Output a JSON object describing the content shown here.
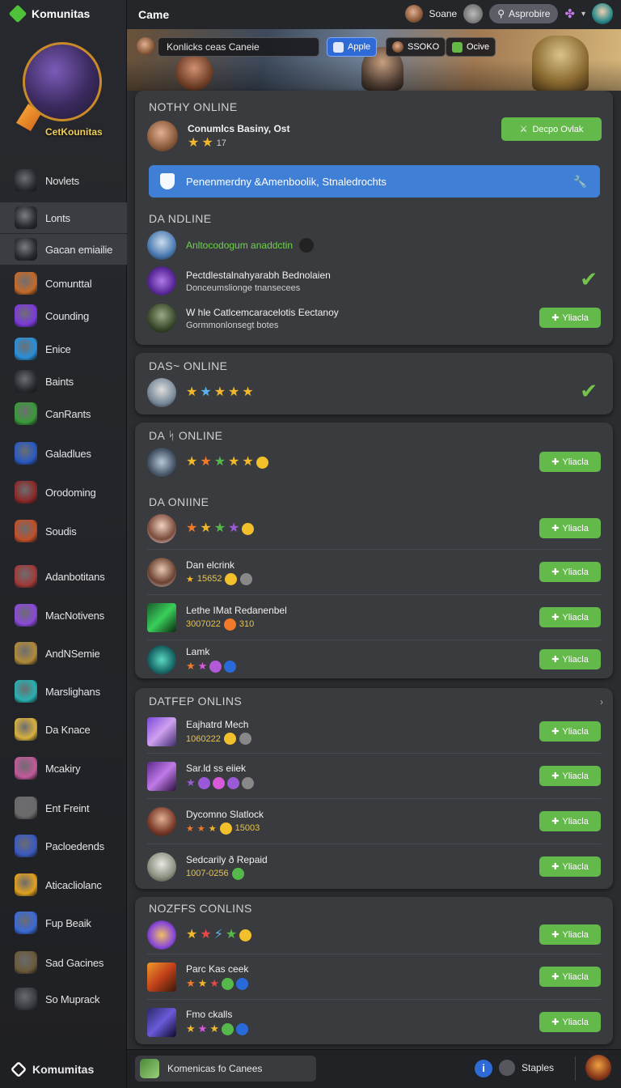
{
  "sidebar": {
    "brand": "Komunitas",
    "hero_label": "CetKounitas",
    "items": [
      {
        "label": "Novlets",
        "icon": "ninja-icon",
        "color": "#2b2d33"
      },
      {
        "label": "Lonts",
        "icon": "gear-icon",
        "color": "#2a2c31"
      },
      {
        "label": "Gacan emiailie",
        "icon": "plus-box-icon",
        "color": "#2a2c31"
      },
      {
        "label": "Comunttal",
        "icon": "chest-icon",
        "color": "#c46a2a"
      },
      {
        "label": "Counding",
        "icon": "crystal-icon",
        "color": "#7b3ad8"
      },
      {
        "label": "Enice",
        "icon": "star-icon",
        "color": "#2a8fd8"
      },
      {
        "label": "Baints",
        "icon": "tag-icon",
        "color": "#2a2c31"
      },
      {
        "label": "CanRants",
        "icon": "ranger-icon",
        "color": "#3a9a3a"
      },
      {
        "label": "Galadlues",
        "icon": "sword-icon",
        "color": "#2a5ac0"
      },
      {
        "label": "Orodoming",
        "icon": "mask-icon",
        "color": "#8a2a2a"
      },
      {
        "label": "Soudis",
        "icon": "wings-icon",
        "color": "#c0502a"
      },
      {
        "label": "Adanbotitans",
        "icon": "knight-icon",
        "color": "#a03a3a"
      },
      {
        "label": "MacNotivens",
        "icon": "spark-icon",
        "color": "#8a4ad8"
      },
      {
        "label": "AndNSemie",
        "icon": "owl-icon",
        "color": "#b08a3a"
      },
      {
        "label": "Marslighans",
        "icon": "cross-icon",
        "color": "#2ab0b0"
      },
      {
        "label": "Da Knace",
        "icon": "skull-icon",
        "color": "#d8b040"
      },
      {
        "label": "Mcakiry",
        "icon": "flower-icon",
        "color": "#c05a9a"
      },
      {
        "label": "Ent Freint",
        "icon": "blades-icon",
        "color": "#6a6a6a"
      },
      {
        "label": "Pacloedends",
        "icon": "portrait-icon",
        "color": "#3a5ac0"
      },
      {
        "label": "Aticacliolanc",
        "icon": "shard-icon",
        "color": "#e0a020"
      },
      {
        "label": "Fup Beaik",
        "icon": "hammer-icon",
        "color": "#3a6ad8"
      },
      {
        "label": "Sad Gacines",
        "icon": "helm-icon",
        "color": "#6a5a3a"
      },
      {
        "label": "So Muprack",
        "icon": "shadow-icon",
        "color": "#3a3c42"
      }
    ],
    "footer_label": "Komumitas"
  },
  "topbar": {
    "title": "Came",
    "user_name": "Soane",
    "button_label": "Asprobire",
    "accent": "#5b5e66"
  },
  "banner": {
    "search_value": "Konlicks ceas Caneie",
    "chips": [
      "Apple",
      "SSOKO",
      "Ocive"
    ]
  },
  "panels": {
    "p1": {
      "title": "NOTHY  ONLINE",
      "header_name": "Conumlcs Basiny, Ost",
      "header_count": "17",
      "duo_button": "Decpo Ovlak",
      "alert_text": "Penenmerdny &Amenboolik, Stnaledrochts",
      "subtitle": "DA NDLINE",
      "rows": [
        {
          "name": "Anltocodogum anaddctin",
          "sub": ""
        },
        {
          "name": "Pectdlestalnahyarabh Bednolaien",
          "sub": "Donceumslionge tnansecees"
        },
        {
          "name": "W hle Catlcemcaracelotis Eectanoy",
          "sub": "Gormmonlonsegt botes"
        }
      ]
    },
    "p2": {
      "title": "DAS~ ONLINE"
    },
    "p3": {
      "title": "DA ᛋ ONLINE",
      "subtitle": "DA ONIINE",
      "rows": [
        {
          "name": "Dan elcrink",
          "sub": "15652"
        },
        {
          "name": "Lethe IMat Redanenbel",
          "sub": "3007022",
          "sub2": "310"
        },
        {
          "name": "Lamk",
          "sub": ""
        }
      ]
    },
    "p4": {
      "title": "DATFEP ONLINS",
      "rows": [
        {
          "name": "Eajhatrd Mech",
          "sub": "1060222"
        },
        {
          "name": "Sar.ld ss eiiek",
          "sub": ""
        },
        {
          "name": "Dycomno Slatlock",
          "sub": "15003"
        },
        {
          "name": "Sedcarily ð Repaid",
          "sub": "1007-0256"
        }
      ]
    },
    "p5": {
      "title": "NOZFFS CONLINS",
      "rows": [
        {
          "name": "",
          "sub": ""
        },
        {
          "name": "Parc Kas ceek",
          "sub": ""
        },
        {
          "name": "Fmo ckalls",
          "sub": ""
        }
      ]
    },
    "view_label": "Yliacla"
  },
  "bottombar": {
    "chat_label": "Komenicas fo Canees",
    "status_label": "Staples"
  },
  "colors": {
    "accent_green": "#63b94a",
    "accent_blue": "#3f7fd6",
    "panel_bg": "#3a3b3f"
  }
}
